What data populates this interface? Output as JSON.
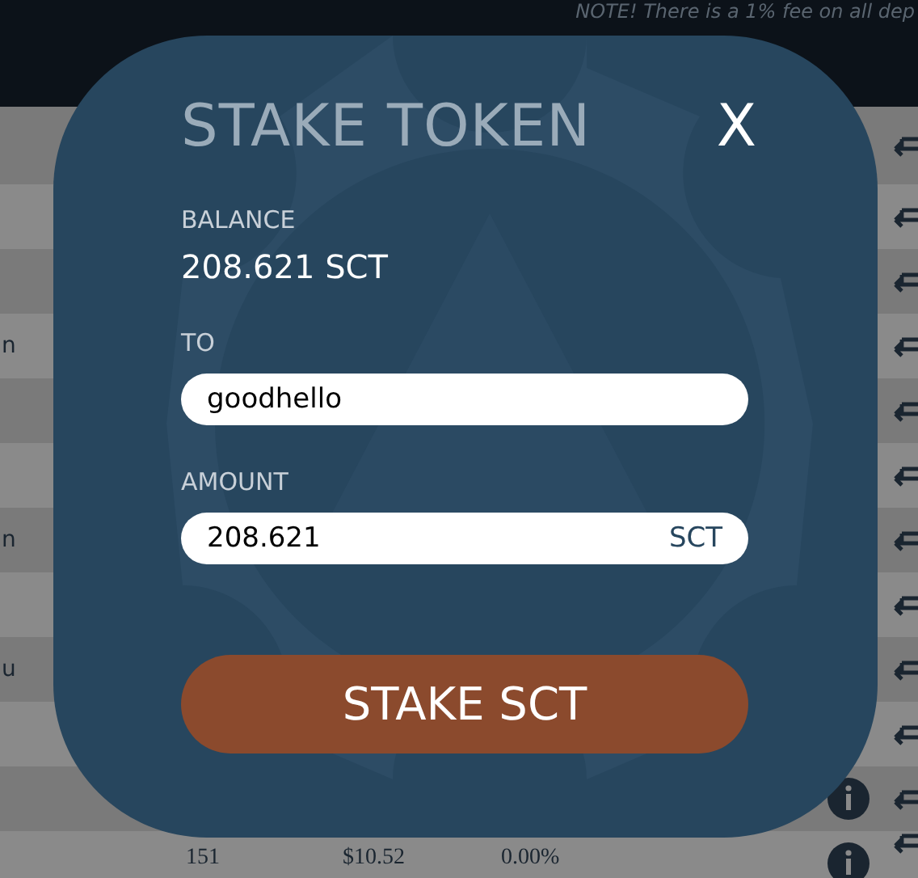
{
  "header": {
    "note": "NOTE! There is a 1% fee on all dep"
  },
  "rows": [
    {
      "info": false
    },
    {
      "info": false
    },
    {
      "info": false
    },
    {
      "column_1": "n",
      "info": false
    },
    {
      "info": false
    },
    {
      "info": false
    },
    {
      "column_1": "n",
      "info": false
    },
    {
      "info": false
    },
    {
      "column_1": "u",
      "info": false
    },
    {
      "info": false
    },
    {
      "info": true
    },
    {
      "column_2": "151",
      "column_3": "$10.52",
      "column_4": "0.00%",
      "info": true
    }
  ],
  "modal": {
    "title": "STAKE TOKEN",
    "close": "X",
    "balance_label": "BALANCE",
    "balance": "208.621 SCT",
    "to_label": "TO",
    "to_value": "goodhello",
    "amount_label": "AMOUNT",
    "amount_value": "208.621",
    "amount_unit": "SCT",
    "button": "STAKE SCT"
  }
}
